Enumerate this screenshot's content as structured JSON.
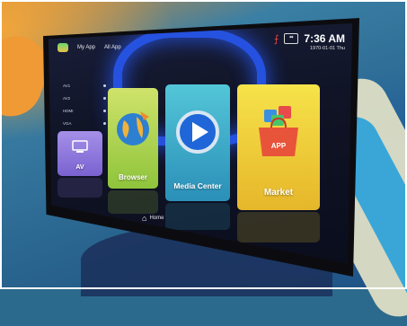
{
  "topbar": {
    "my_app": "My App",
    "all_app": "All App"
  },
  "status": {
    "time": "7:36 AM",
    "date": "1970-01-01 Thu"
  },
  "side_list": [
    "AV1",
    "AV2",
    "HDMI",
    "VGA"
  ],
  "tiles": {
    "av": "AV",
    "browser": "Browser",
    "media_center": "Media Center",
    "market": "Market",
    "market_badge": "APP"
  },
  "home": {
    "label": "Home"
  },
  "colors": {
    "av": "#8a73da",
    "browser": "#a8d24a",
    "media_center": "#3fa9cc",
    "market": "#f0cb38",
    "glow": "#2a5cff"
  }
}
